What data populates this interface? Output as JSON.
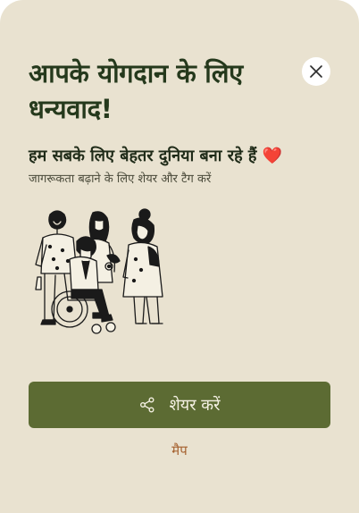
{
  "dialog": {
    "title": "आपके योगदान के लिए धन्यवाद!",
    "subtitle": "हम सबके लिए बेहतर दुनिया बना रहे हैं",
    "subtitle_emoji": "❤️",
    "caption": "जागरूकता बढ़ाने के लिए शेयर और टैग करें",
    "share_button_label": "शेयर करें",
    "map_link_label": "मैप"
  },
  "icons": {
    "close": "close-icon",
    "share": "share-icon",
    "illustration": "people-illustration"
  },
  "colors": {
    "background": "#e9e2d0",
    "title": "#25391c",
    "primary_button": "#5c6b33",
    "link": "#a5612f",
    "heart": "#d81e1e"
  }
}
